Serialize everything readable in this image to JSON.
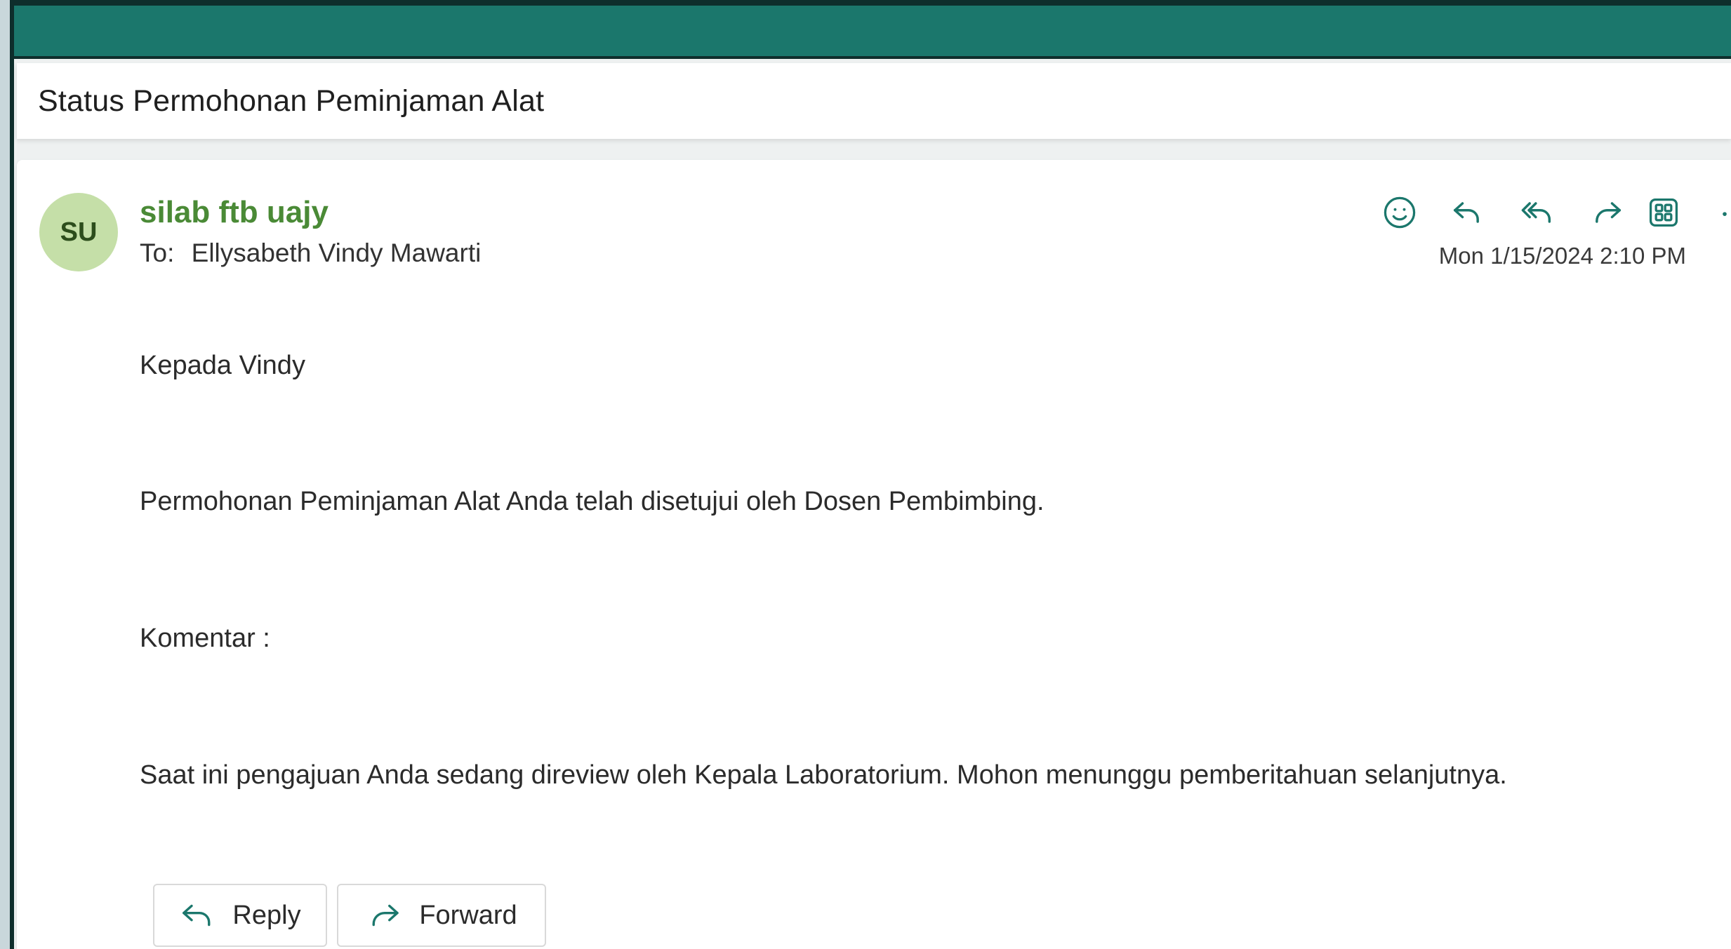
{
  "email": {
    "subject": "Status Permohonan Peminjaman Alat",
    "sender": {
      "initials": "SU",
      "name": "silab ftb uajy",
      "avatar_color": "#c5dfa8",
      "name_color": "#4a8a36"
    },
    "recipient": {
      "label": "To:",
      "name": "Ellysabeth Vindy Mawarti"
    },
    "timestamp": "Mon 1/15/2024 2:10 PM",
    "toolbar": [
      {
        "icon": "smiley-icon",
        "action": "react"
      },
      {
        "icon": "reply-icon",
        "action": "reply"
      },
      {
        "icon": "reply-all-icon",
        "action": "reply-all"
      },
      {
        "icon": "forward-icon",
        "action": "forward"
      },
      {
        "icon": "apps-grid-icon",
        "action": "apps"
      },
      {
        "icon": "more-icon",
        "action": "more"
      }
    ],
    "body": {
      "greeting": "Kepada Vindy",
      "line1": "Permohonan Peminjaman Alat Anda telah disetujui oleh Dosen Pembimbing.",
      "line2": "Komentar :",
      "line3": "Saat ini pengajuan Anda sedang direview oleh Kepala Laboratorium. Mohon menunggu pemberitahuan selanjutnya."
    },
    "buttons": {
      "reply_label": "Reply",
      "forward_label": "Forward"
    }
  },
  "theme": {
    "header_color": "#1b776c",
    "accent_color": "#1b776c"
  }
}
